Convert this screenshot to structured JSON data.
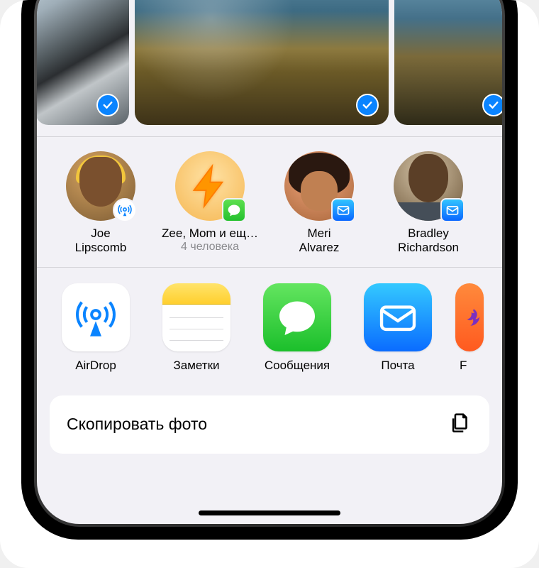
{
  "contacts": [
    {
      "name": "Joe\nLipscomb",
      "badge": "airdrop"
    },
    {
      "name": "Zee, Mom и ещ…",
      "sub": "4 человека",
      "badge": "messages"
    },
    {
      "name": "Meri\nAlvarez",
      "badge": "mail"
    },
    {
      "name": "Bradley\nRichardson",
      "badge": "mail"
    }
  ],
  "apps": [
    {
      "label": "AirDrop"
    },
    {
      "label": "Заметки"
    },
    {
      "label": "Сообщения"
    },
    {
      "label": "Почта"
    },
    {
      "label": "F"
    }
  ],
  "action": {
    "copy_label": "Скопировать фото"
  }
}
